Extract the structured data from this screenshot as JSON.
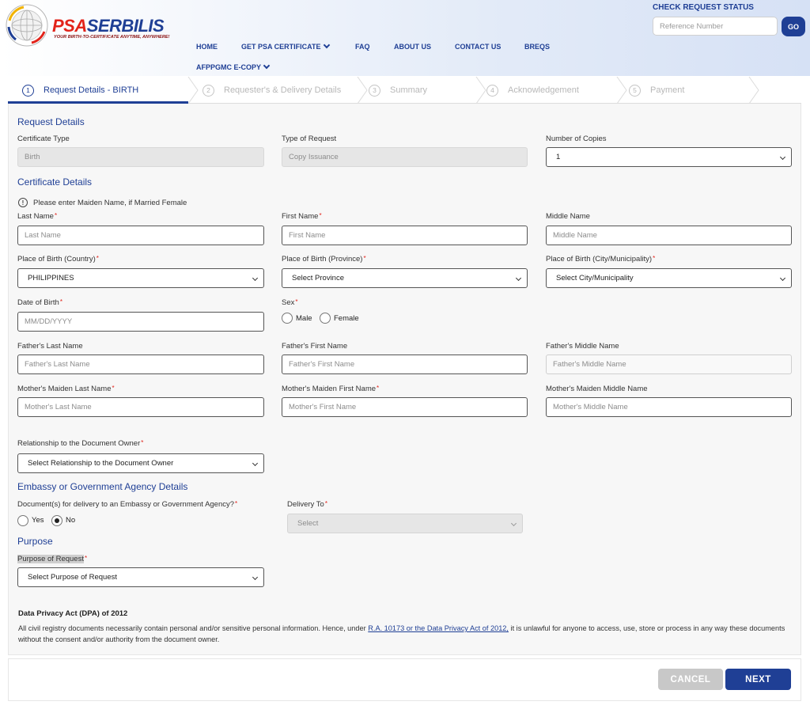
{
  "header": {
    "brand_prefix": "PSA",
    "brand_suffix": "SERBILIS",
    "tagline": "YOUR BIRTH-TO-CERTIFICATE ANYTIME, ANYWHERE!",
    "nav": {
      "home": "HOME",
      "get_certificate": "GET PSA CERTIFICATE",
      "faq": "FAQ",
      "about": "ABOUT US",
      "contact": "CONTACT US",
      "breqs": "BREQS",
      "afppgmc": "AFPPGMC E-COPY"
    },
    "check_status": {
      "title": "CHECK REQUEST STATUS",
      "placeholder": "Reference Number",
      "go_label": "GO"
    }
  },
  "stepper": [
    {
      "num": "1",
      "label": "Request Details - BIRTH"
    },
    {
      "num": "2",
      "label": "Requester's & Delivery Details"
    },
    {
      "num": "3",
      "label": "Summary"
    },
    {
      "num": "4",
      "label": "Acknowledgement"
    },
    {
      "num": "5",
      "label": "Payment"
    }
  ],
  "request_details": {
    "title": "Request Details",
    "certificate_type_label": "Certificate Type",
    "certificate_type_value": "Birth",
    "type_of_request_label": "Type of Request",
    "type_of_request_value": "Copy Issuance",
    "copies_label": "Number of Copies",
    "copies_value": "1"
  },
  "certificate_details": {
    "title": "Certificate Details",
    "note": "Please enter Maiden Name, if Married Female",
    "last_name_label": "Last Name",
    "last_name_placeholder": "Last Name",
    "first_name_label": "First Name",
    "first_name_placeholder": "First Name",
    "middle_name_label": "Middle Name",
    "middle_name_placeholder": "Middle Name",
    "pob_country_label": "Place of Birth (Country)",
    "pob_country_value": "PHILIPPINES",
    "pob_province_label": "Place of Birth (Province)",
    "pob_province_value": "Select Province",
    "pob_city_label": "Place of Birth (City/Municipality)",
    "pob_city_value": "Select City/Municipality",
    "dob_label": "Date of Birth",
    "dob_placeholder": "MM/DD/YYYY",
    "sex_label": "Sex",
    "sex_male": "Male",
    "sex_female": "Female",
    "father_last_label": "Father's Last Name",
    "father_last_placeholder": "Father's Last Name",
    "father_first_label": "Father's First Name",
    "father_first_placeholder": "Father's First Name",
    "father_middle_label": "Father's Middle Name",
    "father_middle_placeholder": "Father's Middle Name",
    "mother_last_label": "Mother's Maiden Last Name",
    "mother_last_placeholder": "Mother's Last Name",
    "mother_first_label": "Mother's Maiden First Name",
    "mother_first_placeholder": "Mother's First Name",
    "mother_middle_label": "Mother's Maiden Middle Name",
    "mother_middle_placeholder": "Mother's Middle Name",
    "relationship_label": "Relationship to the Document Owner",
    "relationship_value": "Select Relationship to the Document Owner"
  },
  "embassy": {
    "title": "Embassy or Government Agency Details",
    "question_label": "Document(s) for delivery to an Embassy or Government Agency?",
    "yes_label": "Yes",
    "no_label": "No",
    "selected": "No",
    "delivery_to_label": "Delivery To",
    "delivery_to_value": "Select"
  },
  "purpose": {
    "title": "Purpose",
    "label": "Purpose of Request",
    "value": "Select Purpose of Request"
  },
  "privacy": {
    "title": "Data Privacy Act (DPA) of 2012",
    "text_before": "All civil registry documents necessarily contain personal and/or sensitive personal information. Hence, under ",
    "link": "R.A. 10173 or the Data Privacy Act of 2012,",
    "text_after": " it is unlawful for anyone to access, use, store or process in any way these documents without the consent and/or authority from the document owner."
  },
  "actions": {
    "cancel": "CANCEL",
    "next": "NEXT"
  },
  "colors": {
    "brand_blue": "#1f3f95",
    "brand_red": "#e2231a",
    "required_star": "#e2231a"
  }
}
